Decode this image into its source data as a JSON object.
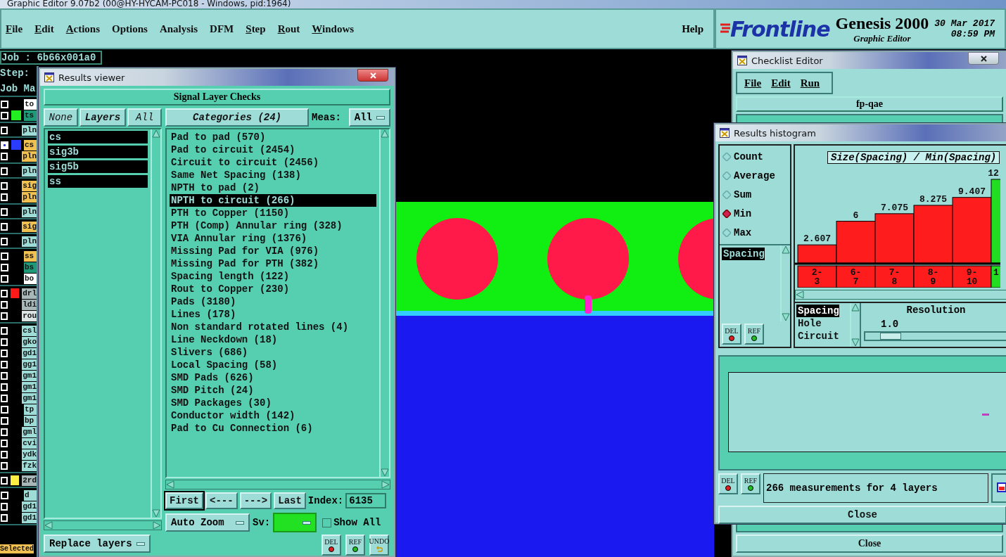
{
  "window": {
    "title": "Graphic Editor 9.07b2 (00@HY-HYCAM-PC018 - Windows, pid:1964)"
  },
  "menu": [
    {
      "label": "File",
      "mnemonic": true
    },
    {
      "label": "Edit",
      "mnemonic": true
    },
    {
      "label": "Actions",
      "mnemonic": true
    },
    {
      "label": "Options",
      "mnemonic": false
    },
    {
      "label": "Analysis",
      "mnemonic": false
    },
    {
      "label": "DFM",
      "mnemonic": false
    },
    {
      "label": "Step",
      "mnemonic": true
    },
    {
      "label": "Rout",
      "mnemonic": true
    },
    {
      "label": "Windows",
      "mnemonic": true
    }
  ],
  "help": "Help",
  "branding": {
    "logo": "Frontline",
    "product": "Genesis 2000",
    "subtitle": "Graphic Editor",
    "date": "30 Mar 2017",
    "time": "08:59 PM"
  },
  "job_panel": {
    "job": "Job : 6b66x001a0",
    "step": "Step:",
    "header": "Job Ma",
    "footer": "Selected",
    "groups": [
      [
        {
          "name": "to",
          "color": "#ffffff",
          "selected": false
        },
        {
          "name": "ts",
          "color": "#1f9a78",
          "swatch": {
            "color": "#22ee22"
          },
          "selected": false
        }
      ],
      [
        {
          "name": "pln",
          "color": "#9edcd8",
          "selected": false
        }
      ],
      [
        {
          "name": "cs",
          "color": "#f0c050",
          "swatch": {
            "color": "#2a3cff"
          },
          "selected": true
        },
        {
          "name": "pln",
          "color": "#f0c050",
          "selected": false
        }
      ],
      [
        {
          "name": "pln",
          "color": "#9edcd8",
          "selected": false
        }
      ],
      [
        {
          "name": "sig",
          "color": "#f0c050",
          "selected": false
        },
        {
          "name": "pln",
          "color": "#f0c050",
          "selected": false
        }
      ],
      [
        {
          "name": "pln",
          "color": "#9edcd8",
          "selected": false
        }
      ],
      [
        {
          "name": "sig",
          "color": "#f0c050",
          "selected": false
        }
      ],
      [
        {
          "name": "pln",
          "color": "#9edcd8",
          "selected": false
        }
      ],
      [
        {
          "name": "ss",
          "color": "#f0c050",
          "selected": false
        },
        {
          "name": "bs",
          "color": "#1f9a78",
          "selected": false
        },
        {
          "name": "bo",
          "color": "#ffffff",
          "selected": false
        }
      ],
      [
        {
          "name": "drl",
          "color": "#a8b8b8",
          "swatch": {
            "color": "#ff1a1a"
          },
          "selected": false
        },
        {
          "name": "ldi",
          "color": "#a8b8b8",
          "selected": false
        },
        {
          "name": "rou",
          "color": "#dde4e4",
          "selected": false
        }
      ],
      [
        {
          "name": "csl",
          "color": "#9edcd8",
          "selected": false
        },
        {
          "name": "gko",
          "color": "#9edcd8",
          "selected": false
        },
        {
          "name": "gd1",
          "color": "#9edcd8",
          "selected": false
        },
        {
          "name": "gg1",
          "color": "#9edcd8",
          "selected": false
        },
        {
          "name": "gm1",
          "color": "#9edcd8",
          "selected": false
        },
        {
          "name": "gm1",
          "color": "#9edcd8",
          "selected": false
        },
        {
          "name": "gm1",
          "color": "#9edcd8",
          "selected": false
        },
        {
          "name": "tp",
          "color": "#9edcd8",
          "selected": false
        },
        {
          "name": "bp",
          "color": "#9edcd8",
          "selected": false
        },
        {
          "name": "gml",
          "color": "#9edcd8",
          "selected": false
        },
        {
          "name": "cvi",
          "color": "#9edcd8",
          "selected": false
        },
        {
          "name": "ydk",
          "color": "#9edcd8",
          "selected": false
        },
        {
          "name": "fzk",
          "color": "#9edcd8",
          "selected": false
        }
      ],
      [
        {
          "name": "2rd",
          "color": "#a8b8b8",
          "swatch": {
            "color": "#ffee44"
          },
          "selected": false
        }
      ],
      [
        {
          "name": "d",
          "color": "#9edcd8",
          "selected": false
        },
        {
          "name": "gd1",
          "color": "#9edcd8",
          "selected": false
        },
        {
          "name": "gd1",
          "color": "#9edcd8",
          "selected": false
        }
      ]
    ]
  },
  "results_viewer": {
    "title": "Results viewer",
    "header": "Signal Layer Checks",
    "layer_buttons": [
      {
        "label": "None",
        "kind": "italic"
      },
      {
        "label": "Layers",
        "kind": "bold"
      },
      {
        "label": "All",
        "kind": "italic"
      }
    ],
    "layers": [
      {
        "label": "cs",
        "selected": true
      },
      {
        "label": "sig3b",
        "selected": true
      },
      {
        "label": "sig5b",
        "selected": true
      },
      {
        "label": "ss",
        "selected": true
      }
    ],
    "replace": "Replace layers",
    "categories_button": "Categories (24)",
    "meas_label": "Meas:",
    "meas_value": "All",
    "categories": [
      {
        "label": "Pad to pad (570)",
        "selected": false
      },
      {
        "label": "Pad to circuit (2454)",
        "selected": false
      },
      {
        "label": "Circuit to circuit (2456)",
        "selected": false
      },
      {
        "label": "Same Net Spacing (138)",
        "selected": false
      },
      {
        "label": "NPTH to pad (2)",
        "selected": false
      },
      {
        "label": "NPTH to circuit (266)",
        "selected": true
      },
      {
        "label": "PTH to Copper (1150)",
        "selected": false
      },
      {
        "label": "PTH (Comp) Annular ring (328)",
        "selected": false
      },
      {
        "label": "VIA Annular ring (1376)",
        "selected": false
      },
      {
        "label": "Missing Pad for VIA (976)",
        "selected": false
      },
      {
        "label": "Missing Pad for PTH (382)",
        "selected": false
      },
      {
        "label": "Spacing length (122)",
        "selected": false
      },
      {
        "label": "Rout to Copper (230)",
        "selected": false
      },
      {
        "label": "Pads (3180)",
        "selected": false
      },
      {
        "label": "Lines (178)",
        "selected": false
      },
      {
        "label": "Non standard rotated lines (4)",
        "selected": false
      },
      {
        "label": "Line Neckdown (18)",
        "selected": false
      },
      {
        "label": "Slivers (686)",
        "selected": false
      },
      {
        "label": "Local Spacing (58)",
        "selected": false
      },
      {
        "label": "SMD Pads (626)",
        "selected": false
      },
      {
        "label": "SMD Pitch (24)",
        "selected": false
      },
      {
        "label": "SMD Packages (30)",
        "selected": false
      },
      {
        "label": "Conductor width (142)",
        "selected": false
      },
      {
        "label": "Pad to Cu Connection (6)",
        "selected": false
      }
    ],
    "nav": [
      {
        "label": "First",
        "selected": true
      },
      {
        "label": "<---",
        "selected": false
      },
      {
        "label": "--->",
        "selected": false
      },
      {
        "label": "Last",
        "selected": false
      }
    ],
    "index_label": "Index:",
    "index_value": "6135",
    "zoom": "Auto Zoom",
    "sv": {
      "label": "Sv:",
      "color": "#22e022"
    },
    "show_all": {
      "label": "Show All",
      "checked": false
    },
    "actions": [
      {
        "label": "DEL",
        "kind": "del"
      },
      {
        "label": "REF",
        "kind": "ref"
      },
      {
        "label": "UNDO",
        "kind": "undo"
      }
    ]
  },
  "checklist_editor": {
    "title": "Checklist Editor",
    "menu": [
      "File",
      "Edit",
      "Run"
    ],
    "name": "fp-qae",
    "close": "Close"
  },
  "histogram": {
    "title": "Results histogram",
    "modes": [
      {
        "label": "Count",
        "selected": false
      },
      {
        "label": "Average",
        "selected": false
      },
      {
        "label": "Sum",
        "selected": false
      },
      {
        "label": "Min",
        "selected": true
      },
      {
        "label": "Max",
        "selected": false
      }
    ],
    "attributes": [
      {
        "label": "Spacing",
        "selected": true
      }
    ],
    "side_actions": [
      {
        "label": "DEL",
        "kind": "del"
      },
      {
        "label": "REF",
        "kind": "ref"
      }
    ],
    "chart_data": {
      "type": "bar",
      "title": "Size(Spacing) / Min(Spacing)",
      "categories": [
        "2-3",
        "6-7",
        "7-8",
        "8-9",
        "9-10",
        "1"
      ],
      "data_labels": true,
      "series": [
        {
          "color": "#ff1c1c",
          "values": [
            2.607,
            6,
            7.075,
            8.275,
            9.407,
            null
          ]
        },
        {
          "color": "#22dd22",
          "values": [
            null,
            null,
            null,
            null,
            null,
            12
          ]
        }
      ]
    },
    "measures": [
      {
        "label": "Spacing",
        "selected": true
      },
      {
        "label": "Hole",
        "selected": false
      },
      {
        "label": "Circuit",
        "selected": false
      }
    ],
    "resolution": {
      "label": "Resolution",
      "value": "1.0",
      "level": 0.12
    },
    "bottom_actions": [
      {
        "label": "DEL",
        "kind": "del"
      },
      {
        "label": "REF",
        "kind": "ref"
      }
    ],
    "status": "266 measurements for 4 layers",
    "close": "Close"
  }
}
